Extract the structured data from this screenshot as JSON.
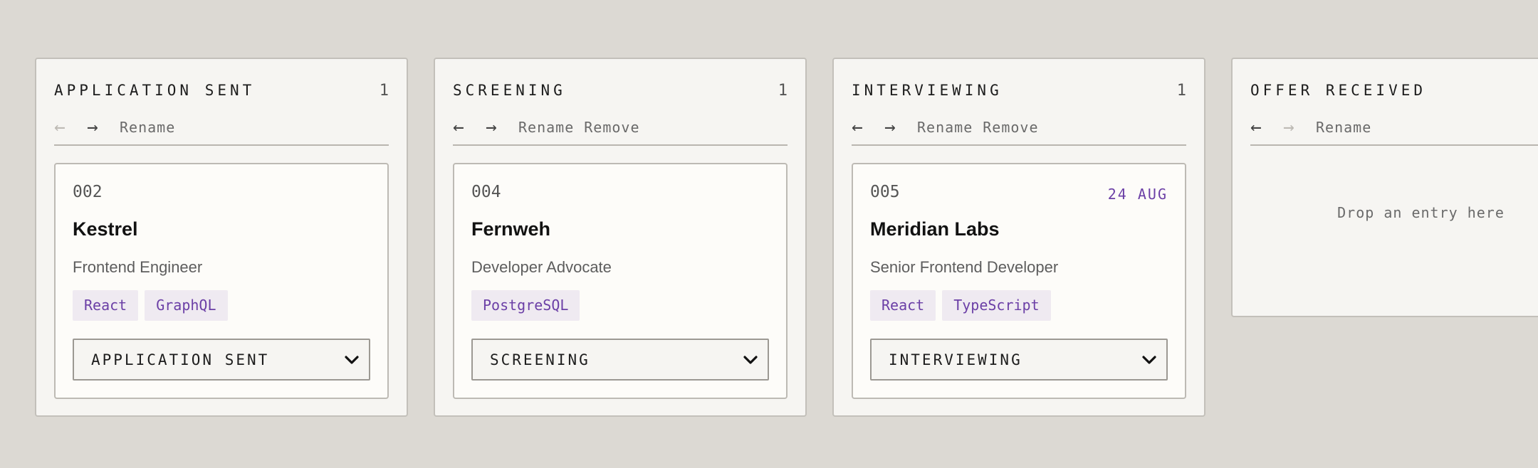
{
  "columns": [
    {
      "title": "APPLICATION SENT",
      "count": "1",
      "prev_arrow": "←",
      "next_arrow": "→",
      "rename_label": "Rename",
      "card": {
        "id": "002",
        "company": "Kestrel",
        "role": "Frontend Engineer",
        "tags": [
          "React",
          "GraphQL"
        ],
        "status": "APPLICATION SENT"
      }
    },
    {
      "title": "SCREENING",
      "count": "1",
      "prev_arrow": "←",
      "next_arrow": "→",
      "rename_label": "Rename",
      "remove_label": "Remove",
      "card": {
        "id": "004",
        "company": "Fernweh",
        "role": "Developer Advocate",
        "tags": [
          "PostgreSQL"
        ],
        "status": "SCREENING"
      }
    },
    {
      "title": "INTERVIEWING",
      "count": "1",
      "prev_arrow": "←",
      "next_arrow": "→",
      "rename_label": "Rename",
      "remove_label": "Remove",
      "card": {
        "id": "005",
        "date": "24 AUG",
        "company": "Meridian Labs",
        "role": "Senior Frontend Developer",
        "tags": [
          "React",
          "TypeScript"
        ],
        "status": "INTERVIEWING"
      }
    },
    {
      "title": "OFFER RECEIVED",
      "prev_arrow": "←",
      "next_arrow": "→",
      "rename_label": "Rename",
      "empty_text": "Drop an entry here"
    }
  ],
  "colors": {
    "background": "#dcd9d3",
    "column_bg": "#f6f5f2",
    "card_bg": "#fdfcf9",
    "accent": "#6b3fa6",
    "tag_bg": "#efeaf1"
  }
}
